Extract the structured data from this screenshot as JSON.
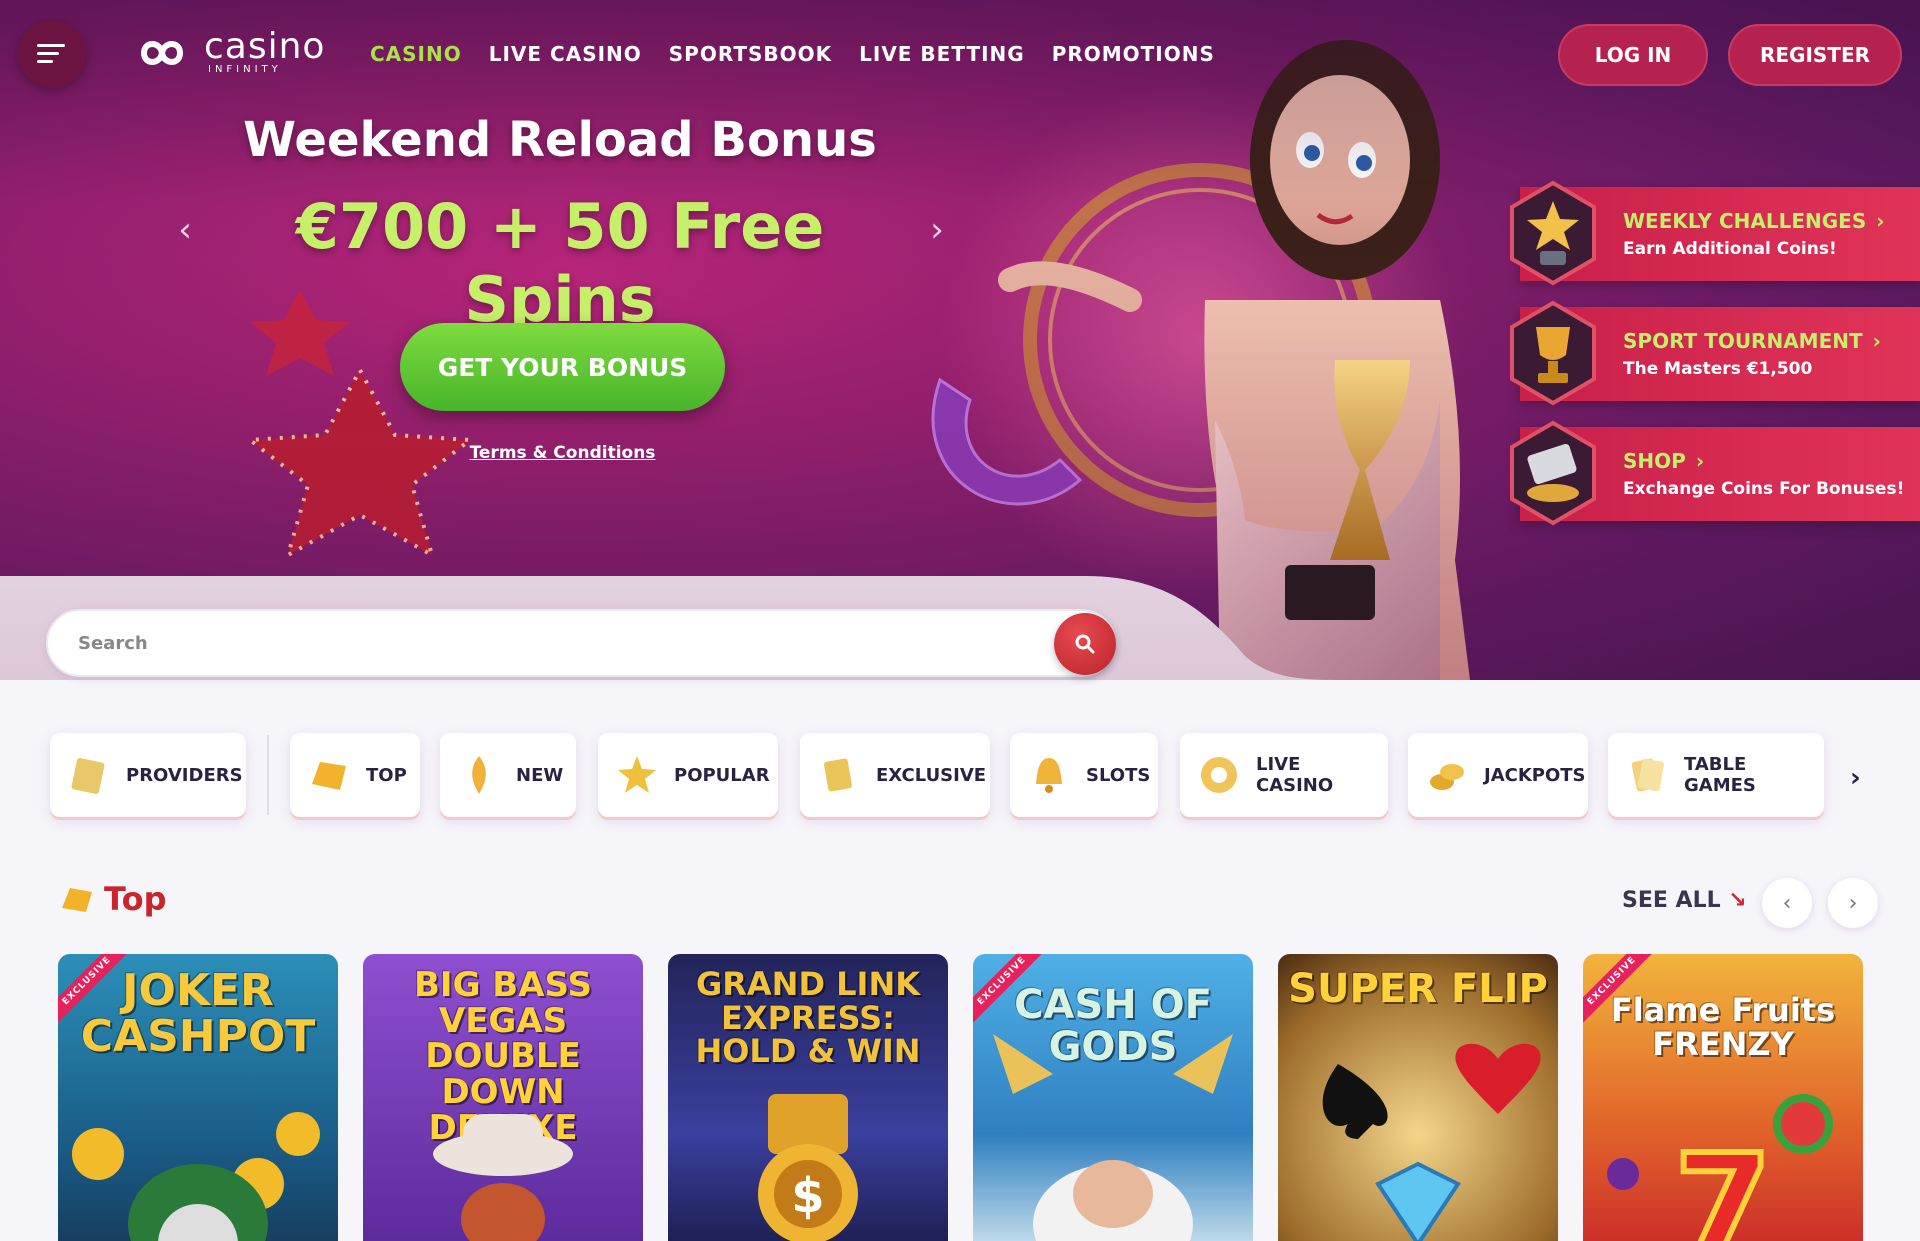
{
  "header": {
    "logo_word": "casino",
    "logo_sub": "INFINITY",
    "nav": [
      "CASINO",
      "LIVE CASINO",
      "SPORTSBOOK",
      "LIVE BETTING",
      "PROMOTIONS"
    ],
    "login": "LOG IN",
    "register": "REGISTER"
  },
  "banner": {
    "title": "Weekend Reload Bonus",
    "offer": "€700  + 50 Free Spins",
    "cta": "GET YOUR BONUS",
    "terms": "Terms & Conditions"
  },
  "promos": [
    {
      "title": "WEEKLY CHALLENGES",
      "subtitle": "Earn Additional Coins!"
    },
    {
      "title": "SPORT TOURNAMENT",
      "subtitle": "The Masters €1,500"
    },
    {
      "title": "SHOP",
      "subtitle": "Exchange Coins For Bonuses!"
    }
  ],
  "search": {
    "placeholder": "Search"
  },
  "categories": [
    "PROVIDERS",
    "TOP",
    "NEW",
    "POPULAR",
    "EXCLUSIVE",
    "SLOTS",
    "LIVE CASINO",
    "JACKPOTS",
    "TABLE GAMES"
  ],
  "section": {
    "title": "Top",
    "see_all": "SEE ALL"
  },
  "games": [
    {
      "name": "JOKER CASHPOT",
      "badge": "EXCLUSIVE"
    },
    {
      "name": "BIG BASS VEGAS DOUBLE DOWN DELUXE",
      "badge": ""
    },
    {
      "name": "GRAND LINK EXPRESS: HOLD & WIN",
      "badge": ""
    },
    {
      "name": "CASH OF GODS",
      "badge": "EXCLUSIVE"
    },
    {
      "name": "SUPER FLIP",
      "badge": ""
    },
    {
      "name": "Flame Fruits FRENZY",
      "badge": "EXCLUSIVE"
    }
  ],
  "colors": {
    "accent_green": "#a8e34a",
    "brand_red": "#c8262d",
    "promo_red": "#d8284f"
  }
}
